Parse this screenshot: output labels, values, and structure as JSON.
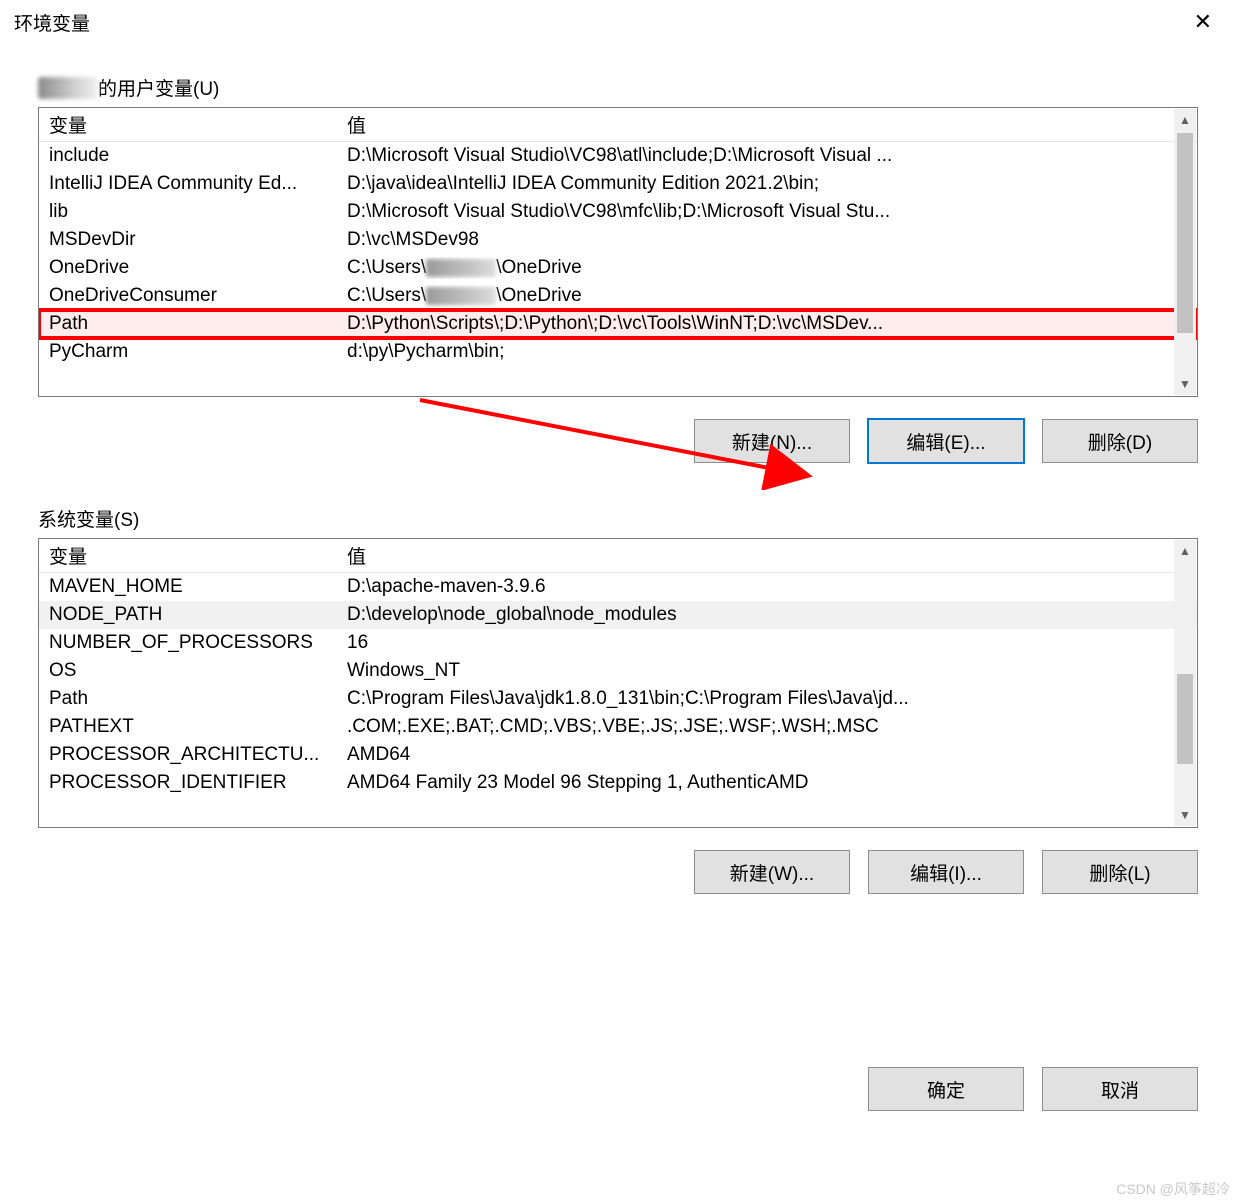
{
  "window": {
    "title": "环境变量"
  },
  "user_section": {
    "label_suffix": "的用户变量(U)",
    "headers": {
      "var": "变量",
      "val": "值"
    },
    "rows": [
      {
        "var": "include",
        "val": "D:\\Microsoft Visual Studio\\VC98\\atl\\include;D:\\Microsoft Visual ..."
      },
      {
        "var": "IntelliJ IDEA Community Ed...",
        "val": "D:\\java\\idea\\IntelliJ IDEA Community Edition 2021.2\\bin;"
      },
      {
        "var": "lib",
        "val": "D:\\Microsoft Visual Studio\\VC98\\mfc\\lib;D:\\Microsoft Visual Stu..."
      },
      {
        "var": "MSDevDir",
        "val": "D:\\vc\\MSDev98"
      },
      {
        "var": "OneDrive",
        "val_prefix": "C:\\Users\\",
        "val_suffix": "\\OneDrive",
        "redacted": true
      },
      {
        "var": "OneDriveConsumer",
        "val_prefix": "C:\\Users\\",
        "val_suffix": "\\OneDrive",
        "redacted": true
      },
      {
        "var": "Path",
        "val": "D:\\Python\\Scripts\\;D:\\Python\\;D:\\vc\\Tools\\WinNT;D:\\vc\\MSDev...",
        "highlight": true
      },
      {
        "var": "PyCharm",
        "val": "d:\\py\\Pycharm\\bin;"
      }
    ],
    "buttons": {
      "new": "新建(N)...",
      "edit": "编辑(E)...",
      "delete": "删除(D)"
    }
  },
  "system_section": {
    "label": "系统变量(S)",
    "headers": {
      "var": "变量",
      "val": "值"
    },
    "rows": [
      {
        "var": "MAVEN_HOME",
        "val": "D:\\apache-maven-3.9.6"
      },
      {
        "var": "NODE_PATH",
        "val": "D:\\develop\\node_global\\node_modules",
        "sel": true
      },
      {
        "var": "NUMBER_OF_PROCESSORS",
        "val": "16"
      },
      {
        "var": "OS",
        "val": "Windows_NT"
      },
      {
        "var": "Path",
        "val": "C:\\Program Files\\Java\\jdk1.8.0_131\\bin;C:\\Program Files\\Java\\jd..."
      },
      {
        "var": "PATHEXT",
        "val": ".COM;.EXE;.BAT;.CMD;.VBS;.VBE;.JS;.JSE;.WSF;.WSH;.MSC"
      },
      {
        "var": "PROCESSOR_ARCHITECTU...",
        "val": "AMD64"
      },
      {
        "var": "PROCESSOR_IDENTIFIER",
        "val": "AMD64 Family 23 Model 96 Stepping 1, AuthenticAMD"
      }
    ],
    "buttons": {
      "new": "新建(W)...",
      "edit": "编辑(I)...",
      "delete": "删除(L)"
    }
  },
  "dialog_buttons": {
    "ok": "确定",
    "cancel": "取消"
  },
  "watermark": "CSDN @风筝超冷"
}
